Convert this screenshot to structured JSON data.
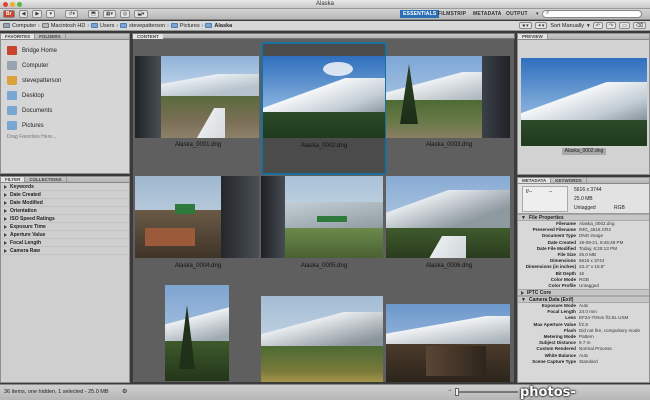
{
  "window": {
    "title": "Alaska"
  },
  "toolbar": {
    "workspaces": [
      "ESSENTIALS",
      "FILMSTRIP",
      "METADATA",
      "OUTPUT"
    ],
    "active_workspace": "ESSENTIALS",
    "sort_label": "Sort Manually",
    "search_icon": "search-icon"
  },
  "path": [
    "Computer",
    "Macintosh HD",
    "Users",
    "stevepatterson",
    "Pictures",
    "Alaska"
  ],
  "left_panel": {
    "tabs": [
      "FAVORITES",
      "FOLDERS"
    ],
    "favorites": [
      {
        "label": "Bridge Home",
        "color": "#c8442c"
      },
      {
        "label": "Computer",
        "color": "#9aa4b0"
      },
      {
        "label": "stevepatterson",
        "color": "#d9a23b"
      },
      {
        "label": "Desktop",
        "color": "#7aa6d4"
      },
      {
        "label": "Documents",
        "color": "#7aa6d4"
      },
      {
        "label": "Pictures",
        "color": "#7aa6d4"
      }
    ],
    "drag_hint": "Drag Favorites Here...",
    "filter_tabs": [
      "FILTER",
      "COLLECTIONS"
    ],
    "filters": [
      "Keywords",
      "Date Created",
      "Date Modified",
      "Orientation",
      "ISO Speed Ratings",
      "Exposure Time",
      "Aperture Value",
      "Focal Length",
      "Camera Raw"
    ]
  },
  "content": {
    "tab": "CONTENT",
    "items": [
      {
        "name": "Alaska_0001.dng"
      },
      {
        "name": "Alaska_0002.dng"
      },
      {
        "name": "Alaska_0003.dng"
      },
      {
        "name": "Alaska_0004.dng"
      },
      {
        "name": "Alaska_0005.dng"
      },
      {
        "name": "Alaska_0006.dng"
      },
      {
        "name": ""
      },
      {
        "name": ""
      },
      {
        "name": ""
      }
    ]
  },
  "preview": {
    "tab": "PREVIEW",
    "caption": "Alaska_0002.dng"
  },
  "metadata": {
    "tabs": [
      "METADATA",
      "KEYWORDS"
    ],
    "summary": {
      "aperture": "f/--",
      "shutter": "--",
      "dims": "5616 x 3744",
      "size": "25.0 MB",
      "profile": "Untagged",
      "mode": "RGB"
    },
    "file_properties_title": "File Properties",
    "file_properties": [
      [
        "Filename",
        "Alaska_0002.dng"
      ],
      [
        "Preserved Filename",
        "IMG_4516.CR2"
      ],
      [
        "Document Type",
        "DNG image"
      ],
      [
        "Date Created",
        "19-09-21, 8:45:48 PM"
      ],
      [
        "Date File Modified",
        "Today, 6:25:13 PM"
      ],
      [
        "File Size",
        "25.0 MB"
      ],
      [
        "Dimensions",
        "5616 x 3744"
      ],
      [
        "Dimensions (in inches)",
        "23.4\" x 15.6\""
      ],
      [
        "Bit Depth",
        "16"
      ],
      [
        "Color Mode",
        "RGB"
      ],
      [
        "Color Profile",
        "Untagged"
      ]
    ],
    "iptc_title": "IPTC Core",
    "camera_title": "Camera Data (Exif)",
    "camera_data": [
      [
        "Exposure Mode",
        "Auto"
      ],
      [
        "Focal Length",
        "24.0 mm"
      ],
      [
        "Lens",
        "EF24-70mm f/2.8L USM"
      ],
      [
        "Max Aperture Value",
        "f/2.8"
      ],
      [
        "Flash",
        "Did not fire, compulsory mode"
      ],
      [
        "Metering Mode",
        "Pattern"
      ],
      [
        "Subject Distance",
        "9.7 m"
      ],
      [
        "Custom Rendered",
        "Normal Process"
      ],
      [
        "White Balance",
        "Auto"
      ],
      [
        "Scene Capture Type",
        "Standard"
      ]
    ]
  },
  "status": {
    "text": "36 items, one hidden, 1 selected - 25.0 MB"
  },
  "watermark": {
    "text": "photos-shop.do.am"
  }
}
